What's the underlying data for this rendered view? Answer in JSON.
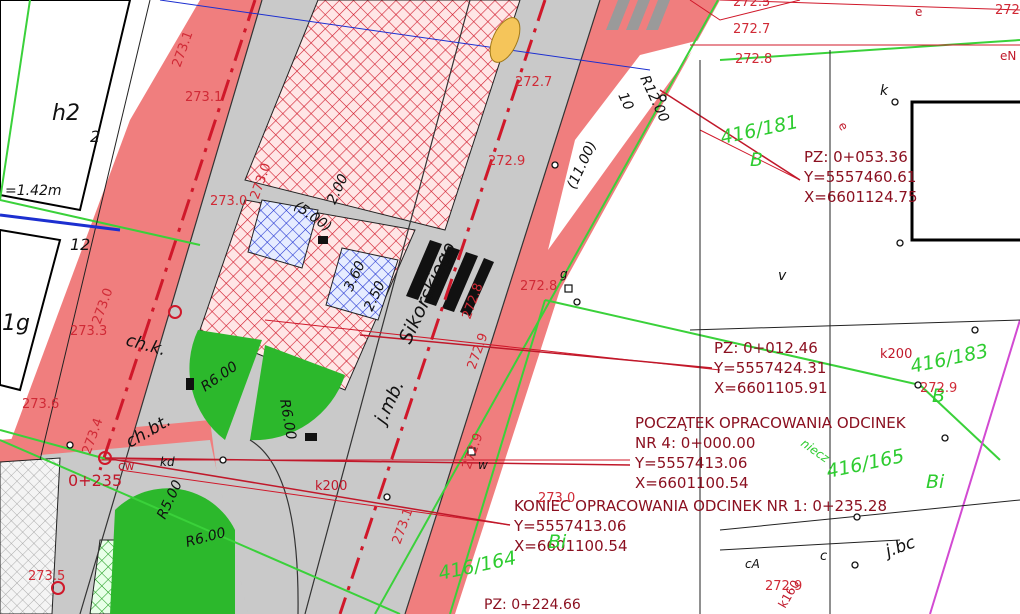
{
  "colors": {
    "road": "#c9c9c9",
    "sidewalk": "#f07e7e",
    "green": "#2cb82c",
    "parcel_line": "#3ad13a",
    "red_line": "#d0182a",
    "label_red": "#8b1020"
  },
  "parcels": [
    {
      "id": "p1",
      "label": "416/181",
      "sub": "B"
    },
    {
      "id": "p2",
      "label": "416/183",
      "sub": "B"
    },
    {
      "id": "p3",
      "label": "416/165",
      "sub": "Bi"
    },
    {
      "id": "p4",
      "label": "416/164",
      "sub": "Bi"
    },
    {
      "id": "p5",
      "label": "h2",
      "sub": ""
    },
    {
      "id": "p6",
      "label": "1g",
      "sub": ""
    }
  ],
  "points": [
    {
      "id": "pz1",
      "lines": [
        "PZ: 0+053.36",
        "Y=5557460.61",
        "X=6601124.75"
      ]
    },
    {
      "id": "pz2",
      "lines": [
        "PZ: 0+012.46",
        "Y=5557424.31",
        "X=6601105.91"
      ]
    },
    {
      "id": "start",
      "lines": [
        "POCZĄTEK OPRACOWANIA ODCINEK",
        "NR 4: 0+000.00",
        "Y=5557413.06",
        "X=6601100.54"
      ]
    },
    {
      "id": "end",
      "lines": [
        "KONIEC OPRACOWANIA ODCINEK NR 1: 0+235.28",
        "Y=5557413.06",
        "X=6601100.54"
      ]
    },
    {
      "id": "pz3",
      "lines": [
        "PZ: 0+224.66"
      ]
    }
  ],
  "elevations": [
    "272.5",
    "272.7",
    "272.8",
    "272.7",
    "272.9",
    "272.8",
    "272.9",
    "272.9",
    "273.0",
    "273.0",
    "273.0",
    "273.3",
    "273.4",
    "273.5",
    "273.6",
    "273.1",
    "273.1",
    "272.9",
    "272.8",
    "272.9",
    "273.0",
    "273.1",
    "272.9"
  ],
  "radii": [
    "R12.00",
    "R6.00",
    "R6.00",
    "R5.00",
    "R6.00"
  ],
  "labels": {
    "street": "Sikorskiego",
    "utility_jmb": "j.mb.",
    "utility_chbt": "ch.bt.",
    "utility_chk": "ch.k.",
    "dim_200": "2.00",
    "dim_250": "2.50",
    "dim_360": "3.60",
    "dim_500": "(5.00)",
    "dim_1100": "(11.00)",
    "dim_10": "10",
    "dim_142": "=1.42m",
    "station_235": "0+235",
    "k200": "k200",
    "k200b": "k200",
    "code_k": "k",
    "code_v": "v",
    "code_w": "w",
    "code_g": "g",
    "code_c": "c",
    "code_en": "eN",
    "code_ca": "cA",
    "code_k160": "k160",
    "code_jbc": "j.bc",
    "code_kd": "kd",
    "code_cw": "cw",
    "code_nieczy": "niecz",
    "code_e1": "e",
    "code_e2": "e",
    "code_2": "2",
    "code_12": "12"
  }
}
